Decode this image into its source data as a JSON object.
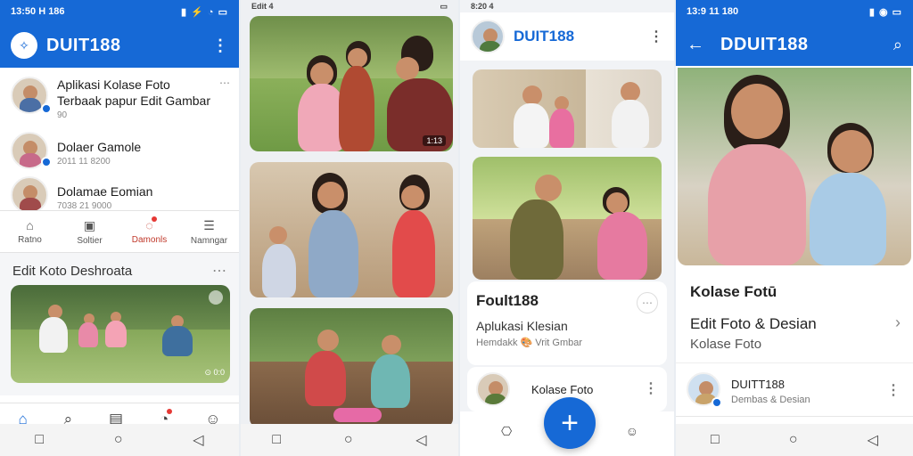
{
  "panel1": {
    "status_time": "13:50 H 186",
    "status_icons": "▮ ⚡ ◔ ▭",
    "app_title": "DUIT188",
    "menu_icon": "more-vert-icon",
    "list": [
      {
        "title": "Aplikasi Kolase Foto Terbaak papur Edit Gambar",
        "sub": "90"
      },
      {
        "title": "Dolaer Gamole",
        "sub": "2011 11 8200"
      },
      {
        "title": "Dolamae Eomian",
        "sub": "7038 21 9000"
      }
    ],
    "tabs": [
      {
        "label": "Ratno",
        "icon": "home-outline-icon"
      },
      {
        "label": "Soltier",
        "icon": "camera-icon"
      },
      {
        "label": "Damonls",
        "icon": "chat-icon",
        "badge": true
      },
      {
        "label": "Namngar",
        "icon": "menu-icon"
      }
    ],
    "section_title": "Edit Koto Deshroata",
    "bottom_nav": [
      "home-icon",
      "search-icon",
      "shop-icon",
      "notification-icon",
      "profile-icon"
    ],
    "timer": "⊙ 0:0"
  },
  "panel2": {
    "status_time": "Edit 4",
    "badge_label": "1:13"
  },
  "panel3": {
    "status_time": "8:20 4",
    "app_title": "DUIT188",
    "card_title": "Foult188",
    "card_subtitle": "Aplukasi Klesian",
    "card_meta": "Hemdakk 🎨 Vrit Gmbar",
    "row_title": "Kolase Foto",
    "fab_label": "+"
  },
  "panel4": {
    "status_time": "13:9 11 180",
    "status_icons": "▮ ◉ ▭",
    "app_title": "DDUIT188",
    "section_heading": "Kolase Fotū",
    "item_title": "Edit Foto & Desian",
    "item_subtitle": "Kolase Foto",
    "row_title": "DUITT188",
    "row_sub": "Dembas & Desian"
  },
  "colors": {
    "brand": "#1669d6",
    "accent_red": "#c0392b",
    "background": "#e9edf2"
  }
}
